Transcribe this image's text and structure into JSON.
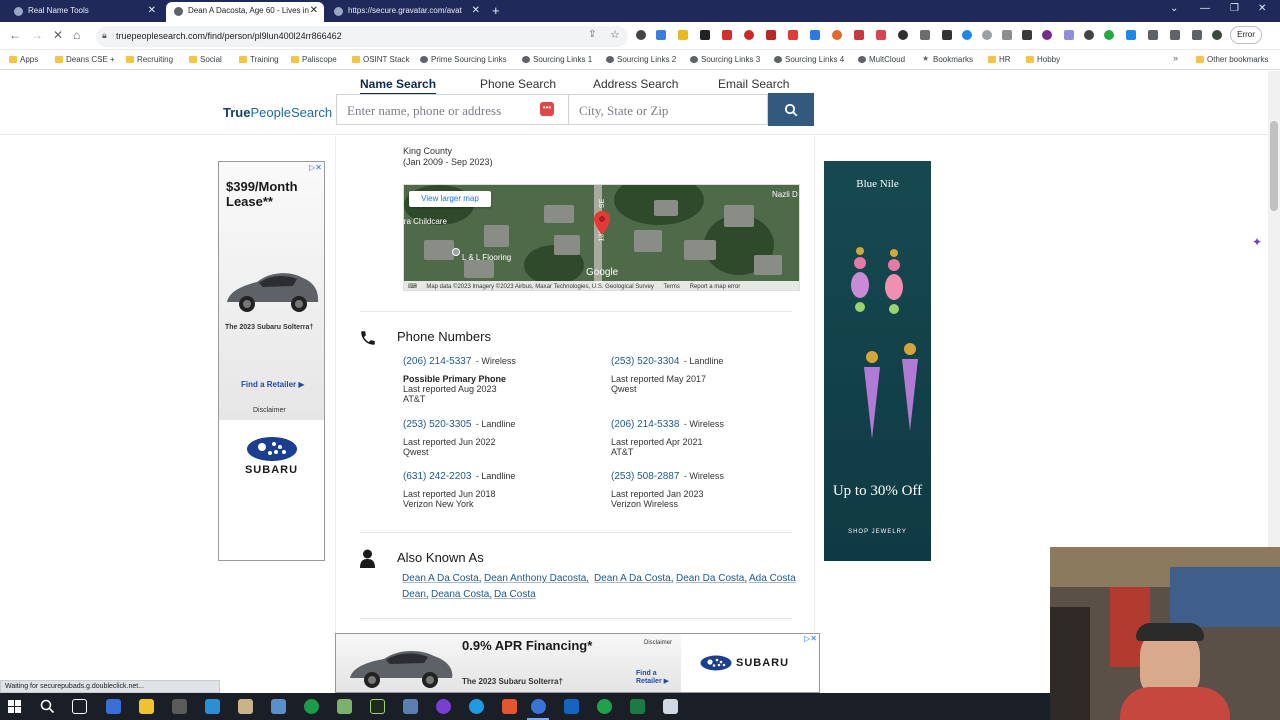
{
  "browser": {
    "tabs": [
      {
        "title": "Real Name Tools",
        "active": false
      },
      {
        "title": "Dean A Dacosta, Age 60 - Lives in",
        "active": true
      },
      {
        "title": "https://secure.gravatar.com/avat",
        "active": false
      }
    ],
    "url": "truepeoplesearch.com/find/person/pl9lun400l24rr866462",
    "error_label": "Error",
    "bookmarks": [
      {
        "label": "Apps",
        "kind": "apps-icon"
      },
      {
        "label": "Deans CSE +",
        "kind": "folder"
      },
      {
        "label": "Recruiting",
        "kind": "folder"
      },
      {
        "label": "Social",
        "kind": "folder"
      },
      {
        "label": "Training",
        "kind": "folder"
      },
      {
        "label": "Paliscope",
        "kind": "folder"
      },
      {
        "label": "OSINT Stack",
        "kind": "folder"
      },
      {
        "label": "Prime Sourcing Links",
        "kind": "globe"
      },
      {
        "label": "Sourcing Links 1",
        "kind": "globe"
      },
      {
        "label": "Sourcing Links 2",
        "kind": "globe"
      },
      {
        "label": "Sourcing Links 3",
        "kind": "globe"
      },
      {
        "label": "Sourcing Links 4",
        "kind": "globe"
      },
      {
        "label": "MultCloud",
        "kind": "globe"
      },
      {
        "label": "Bookmarks",
        "kind": "star"
      },
      {
        "label": "HR",
        "kind": "folder"
      },
      {
        "label": "Hobby",
        "kind": "folder"
      },
      {
        "label": "Other bookmarks",
        "kind": "folder"
      }
    ],
    "status_text": "Waiting for securepubads.g.doubleclick.net..."
  },
  "site": {
    "logo_bold": "True",
    "logo_light": "PeopleSearch",
    "tabs": [
      "Name Search",
      "Phone Search",
      "Address Search",
      "Email Search"
    ],
    "name_placeholder": "Enter name, phone or address",
    "city_placeholder": "City, State or Zip"
  },
  "record": {
    "county": "King County",
    "county_dates": "(Jan 2009 - Sep 2023)",
    "map": {
      "view_larger": "View larger map",
      "labels": [
        "ira Childcare",
        "L & L Flooring",
        "Nazli D",
        "132",
        "SE"
      ],
      "google": "Google",
      "attribution": "Map data ©2023 Imagery ©2023 Airbus, Maxar Technologies, U.S. Geological Survey",
      "terms": "Terms",
      "report": "Report a map error"
    },
    "phones_title": "Phone Numbers",
    "phones": [
      {
        "number": "(206) 214-5337",
        "type": "- Wireless",
        "primary": "Possible Primary Phone",
        "reported": "Last reported Aug 2023",
        "carrier": "AT&T"
      },
      {
        "number": "(253) 520-3304",
        "type": "- Landline",
        "primary": "",
        "reported": "Last reported May 2017",
        "carrier": "Qwest"
      },
      {
        "number": "(253) 520-3305",
        "type": "- Landline",
        "primary": "",
        "reported": "Last reported Jun 2022",
        "carrier": "Qwest"
      },
      {
        "number": "(206) 214-5338",
        "type": "- Wireless",
        "primary": "",
        "reported": "Last reported Apr 2021",
        "carrier": "AT&T"
      },
      {
        "number": "(631) 242-2203",
        "type": "- Landline",
        "primary": "",
        "reported": "Last reported Jun 2018",
        "carrier": "Verizon New York"
      },
      {
        "number": "(253) 508-2887",
        "type": "- Wireless",
        "primary": "",
        "reported": "Last reported Jan 2023",
        "carrier": "Verizon Wireless"
      }
    ],
    "aka_title": "Also Known As",
    "aka": [
      "Dean A Da Costa",
      "Dean Anthony Dacosta",
      "Dean A Da Costa",
      "Dean Da Costa",
      "Ada Costa",
      "Dean",
      "Deana Costa",
      "Da Costa"
    ]
  },
  "ads": {
    "left": {
      "headline": "$399/Month Lease**",
      "model": "The 2023 Subaru Solterra†",
      "cta": "Find a Retailer ▶",
      "disclaimer": "Disclaimer",
      "brand": "SUBARU"
    },
    "right": {
      "brand": "Blue Nile",
      "offer": "Up to 30% Off",
      "cta": "SHOP JEWELRY"
    },
    "bottom": {
      "headline": "0.9% APR Financing*",
      "disclaimer": "Disclaimer",
      "model": "The 2023 Subaru Solterra†",
      "cta": "Find a Retailer ▶",
      "brand": "SUBARU"
    }
  }
}
